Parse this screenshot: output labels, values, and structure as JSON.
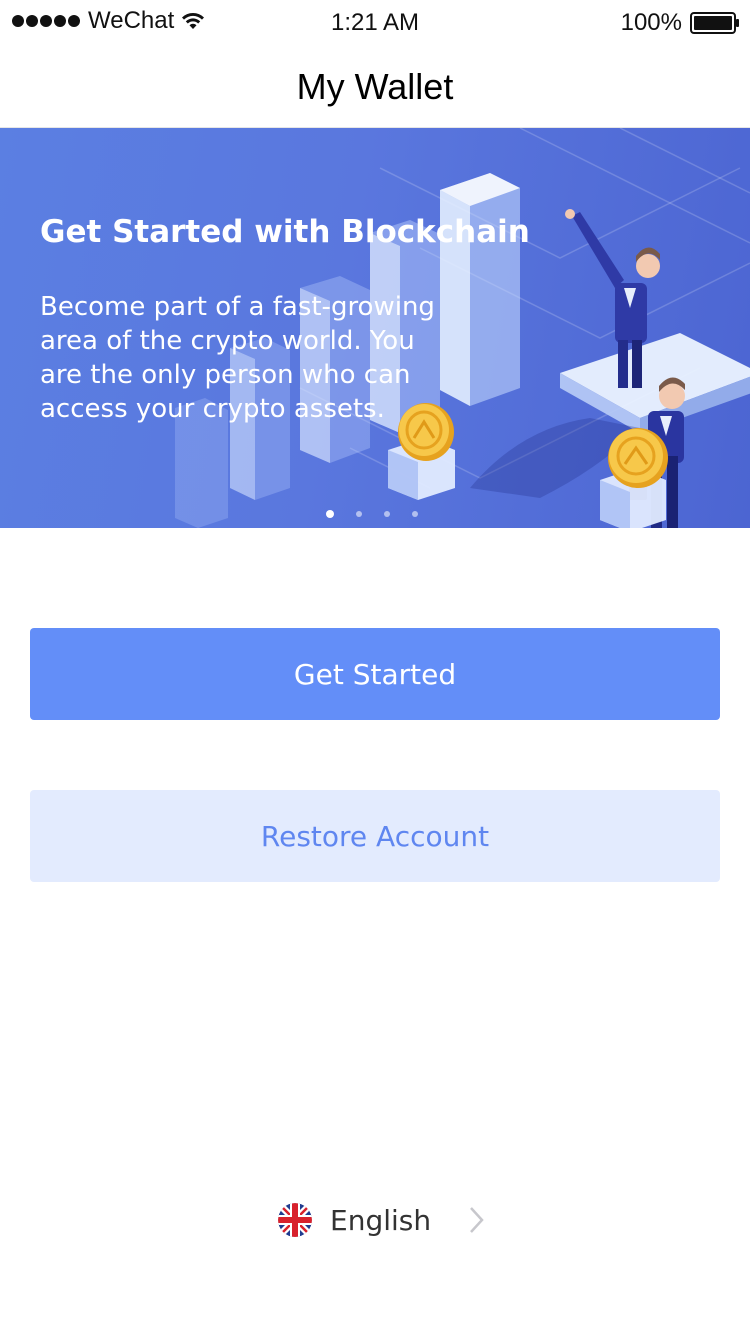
{
  "status_bar": {
    "carrier": "WeChat",
    "time": "1:21 AM",
    "battery": "100%"
  },
  "nav": {
    "title": "My Wallet"
  },
  "banner": {
    "title": "Get Started with Blockchain",
    "description": "Become part of a fast-growing area of the crypto world. You are the only person who can access your crypto assets.",
    "pages": 4,
    "active_page": 1
  },
  "actions": {
    "get_started": "Get Started",
    "restore_account": "Restore Account"
  },
  "language": {
    "label": "English",
    "flag": "uk-flag-icon"
  },
  "colors": {
    "primary": "#638ef8",
    "secondary_bg": "#e3ebfe",
    "secondary_text": "#5f86f0",
    "banner": "#5a77de"
  }
}
